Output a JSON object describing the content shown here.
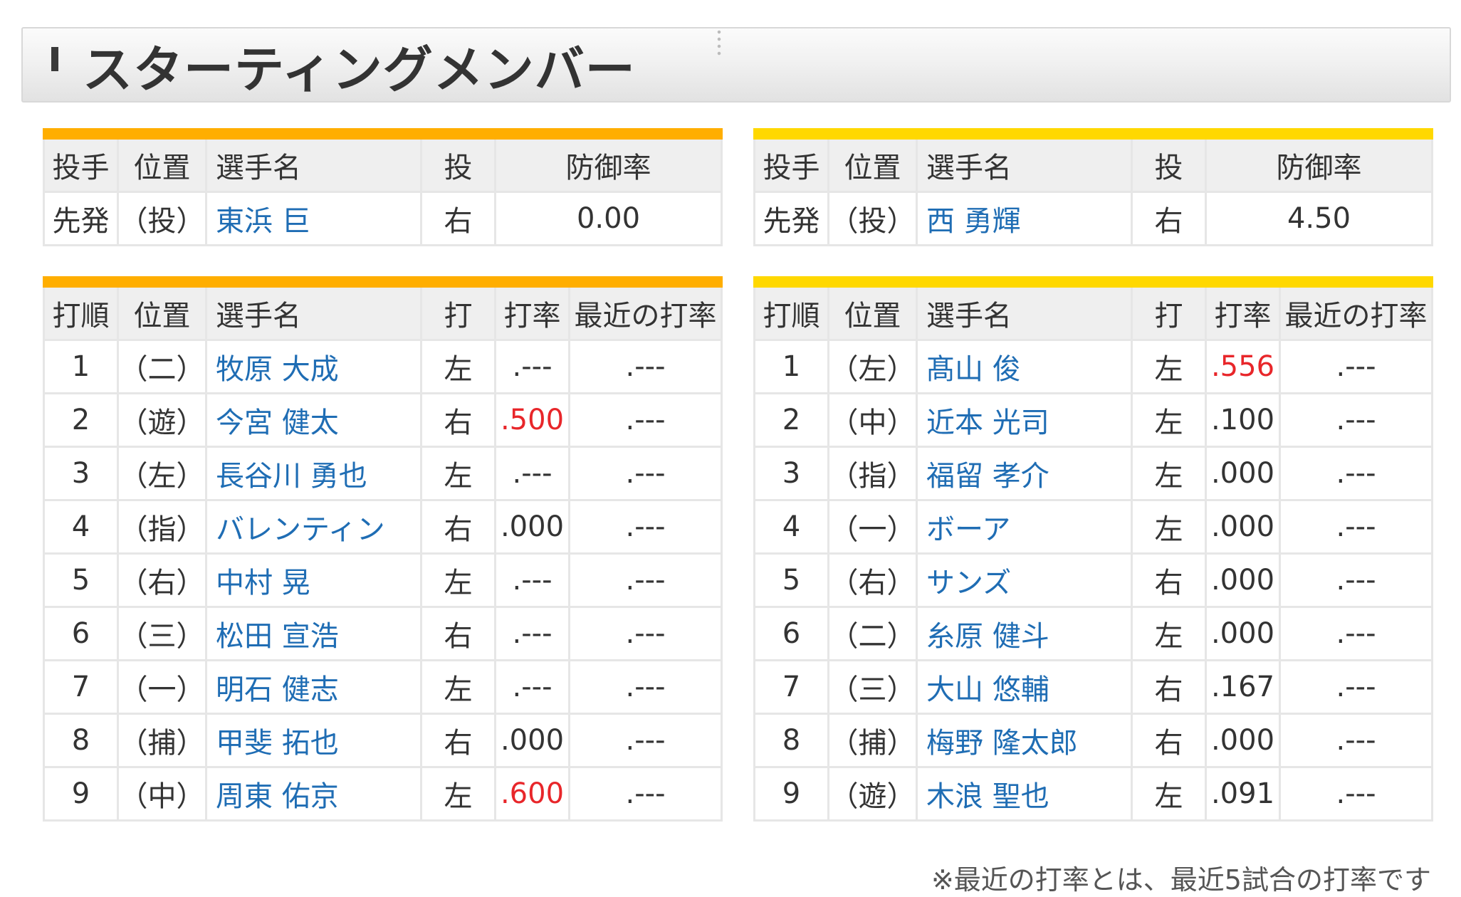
{
  "header": {
    "title": "スターティングメンバー"
  },
  "pitcher_headers": [
    "投手",
    "位置",
    "選手名",
    "投",
    "防御率"
  ],
  "batter_headers": [
    "打順",
    "位置",
    "選手名",
    "打",
    "打率",
    "最近の打率"
  ],
  "left_team": {
    "pitcher": {
      "role": "先発",
      "pos": "（投）",
      "name": "東浜 巨",
      "throws": "右",
      "era": "0.00"
    },
    "batters": [
      {
        "order": "1",
        "pos": "（二）",
        "name": "牧原 大成",
        "bats": "左",
        "avg": ".---",
        "recent": ".---"
      },
      {
        "order": "2",
        "pos": "（遊）",
        "name": "今宮 健太",
        "bats": "右",
        "avg": ".500",
        "recent": ".---"
      },
      {
        "order": "3",
        "pos": "（左）",
        "name": "長谷川 勇也",
        "bats": "左",
        "avg": ".---",
        "recent": ".---"
      },
      {
        "order": "4",
        "pos": "（指）",
        "name": "バレンティン",
        "bats": "右",
        "avg": ".000",
        "recent": ".---"
      },
      {
        "order": "5",
        "pos": "（右）",
        "name": "中村 晃",
        "bats": "左",
        "avg": ".---",
        "recent": ".---"
      },
      {
        "order": "6",
        "pos": "（三）",
        "name": "松田 宣浩",
        "bats": "右",
        "avg": ".---",
        "recent": ".---"
      },
      {
        "order": "7",
        "pos": "（一）",
        "name": "明石 健志",
        "bats": "左",
        "avg": ".---",
        "recent": ".---"
      },
      {
        "order": "8",
        "pos": "（捕）",
        "name": "甲斐 拓也",
        "bats": "右",
        "avg": ".000",
        "recent": ".---"
      },
      {
        "order": "9",
        "pos": "（中）",
        "name": "周東 佑京",
        "bats": "左",
        "avg": ".600",
        "recent": ".---"
      }
    ]
  },
  "right_team": {
    "pitcher": {
      "role": "先発",
      "pos": "（投）",
      "name": "西 勇輝",
      "throws": "右",
      "era": "4.50"
    },
    "batters": [
      {
        "order": "1",
        "pos": "（左）",
        "name": "髙山 俊",
        "bats": "左",
        "avg": ".556",
        "recent": ".---"
      },
      {
        "order": "2",
        "pos": "（中）",
        "name": "近本 光司",
        "bats": "左",
        "avg": ".100",
        "recent": ".---"
      },
      {
        "order": "3",
        "pos": "（指）",
        "name": "福留 孝介",
        "bats": "左",
        "avg": ".000",
        "recent": ".---"
      },
      {
        "order": "4",
        "pos": "（一）",
        "name": "ボーア",
        "bats": "左",
        "avg": ".000",
        "recent": ".---"
      },
      {
        "order": "5",
        "pos": "（右）",
        "name": "サンズ",
        "bats": "右",
        "avg": ".000",
        "recent": ".---"
      },
      {
        "order": "6",
        "pos": "（二）",
        "name": "糸原 健斗",
        "bats": "左",
        "avg": ".000",
        "recent": ".---"
      },
      {
        "order": "7",
        "pos": "（三）",
        "name": "大山 悠輔",
        "bats": "右",
        "avg": ".167",
        "recent": ".---"
      },
      {
        "order": "8",
        "pos": "（捕）",
        "name": "梅野 隆太郎",
        "bats": "右",
        "avg": ".000",
        "recent": ".---"
      },
      {
        "order": "9",
        "pos": "（遊）",
        "name": "木浪 聖也",
        "bats": "左",
        "avg": ".091",
        "recent": ".---"
      }
    ]
  },
  "highlight_avgs": [
    ".500",
    ".600",
    ".556"
  ],
  "colors": {
    "left_accent": "#ffae00",
    "right_accent": "#ffd800",
    "name_link": "#1f6db4",
    "highlight": "#e8262a"
  },
  "footnote": "※最近の打率とは、最近5試合の打率です"
}
